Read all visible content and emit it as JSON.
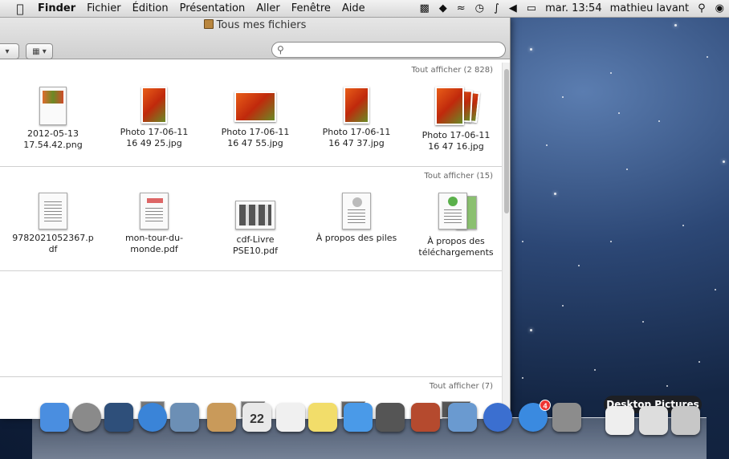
{
  "menubar": {
    "app_name": "Finder",
    "menus": [
      "Fichier",
      "Édition",
      "Présentation",
      "Aller",
      "Fenêtre",
      "Aide"
    ],
    "clock": "mar. 13:54",
    "user": "mathieu lavant"
  },
  "window": {
    "title": "Tous mes fichiers",
    "search_placeholder": ""
  },
  "sections": [
    {
      "show_all": "Tout afficher (2 828)",
      "items": [
        {
          "name": "2012-05-13\n17.54.42.png",
          "kind": "screenshot"
        },
        {
          "name": "Photo 17-06-11\n16 49 25.jpg",
          "kind": "photo"
        },
        {
          "name": "Photo 17-06-11\n16 47 55.jpg",
          "kind": "photo-land"
        },
        {
          "name": "Photo 17-06-11\n16 47 37.jpg",
          "kind": "photo"
        },
        {
          "name": "Photo 17-06-11\n16 47 16.jpg",
          "kind": "stack"
        }
      ]
    },
    {
      "show_all": "Tout afficher (15)",
      "items": [
        {
          "name": "9782021052367.p\ndf",
          "kind": "doc"
        },
        {
          "name": "mon-tour-du-\nmonde.pdf",
          "kind": "doc"
        },
        {
          "name": "cdf-Livre\nPSE10.pdf",
          "kind": "doc-land"
        },
        {
          "name": "À propos des piles",
          "kind": "doc"
        },
        {
          "name": "À propos des\ntéléchargements",
          "kind": "doc"
        }
      ]
    },
    {
      "show_all": "Tout afficher (7)",
      "items": []
    }
  ],
  "dock": {
    "tooltip": "Desktop Pictures",
    "icons": [
      {
        "name": "finder-icon",
        "color": "#4a8ee0"
      },
      {
        "name": "launchpad-icon",
        "color": "#8a8a8a"
      },
      {
        "name": "mission-control-icon",
        "color": "#2e4f7a"
      },
      {
        "name": "safari-icon",
        "color": "#3a84d8"
      },
      {
        "name": "mail-icon",
        "color": "#6c8fb5"
      },
      {
        "name": "contacts-icon",
        "color": "#c99a5a"
      },
      {
        "name": "calendar-icon",
        "color": "#e9e9e9"
      },
      {
        "name": "reminders-icon",
        "color": "#f0f0f0"
      },
      {
        "name": "notes-icon",
        "color": "#f2dd6a"
      },
      {
        "name": "messages-icon",
        "color": "#4a9ae8"
      },
      {
        "name": "facetime-icon",
        "color": "#555555"
      },
      {
        "name": "photo-booth-icon",
        "color": "#b54a2e"
      },
      {
        "name": "iphoto-icon",
        "color": "#6a9ad0"
      },
      {
        "name": "itunes-icon",
        "color": "#3b6fd0"
      },
      {
        "name": "app-store-icon",
        "color": "#3a8ae0"
      },
      {
        "name": "system-preferences-icon",
        "color": "#8c8c8c"
      },
      {
        "name": "documents-stack-icon",
        "color": "#eeeeee"
      },
      {
        "name": "desktop-pictures-stack-icon",
        "color": "#dddddd"
      },
      {
        "name": "trash-icon",
        "color": "#c7c7c7"
      }
    ],
    "app_store_badge": "4",
    "calendar_day": "22"
  }
}
